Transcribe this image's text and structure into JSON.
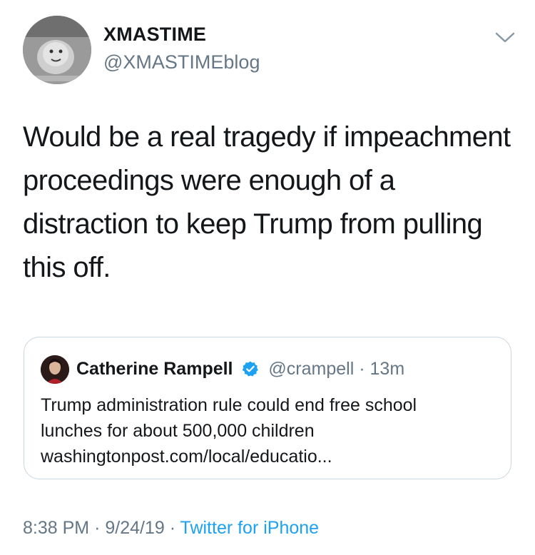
{
  "author": {
    "display_name": "XMASTIME",
    "handle": "@XMASTIMEblog",
    "avatar_icon": "profile-photo"
  },
  "tweet": {
    "text": "Would be a real tragedy if impeachment proceedings were enough of a distraction to keep Trump from pulling this off."
  },
  "quoted_tweet": {
    "name": "Catherine Rampell",
    "verified_icon": "verified-badge-icon",
    "handle": "@crampell",
    "separator": "·",
    "time": "13m",
    "text_lines": [
      "Trump administration rule could end free school",
      "lunches for about 500,000 children",
      "washingtonpost.com/local/educatio..."
    ]
  },
  "meta": {
    "time": "8:38 PM",
    "separator1": "·",
    "date": "9/24/19",
    "separator2": "·",
    "source": "Twitter for iPhone"
  },
  "colors": {
    "text": "#14171a",
    "secondary": "#657786",
    "link": "#1da1f2",
    "border": "#ccd6dd"
  }
}
